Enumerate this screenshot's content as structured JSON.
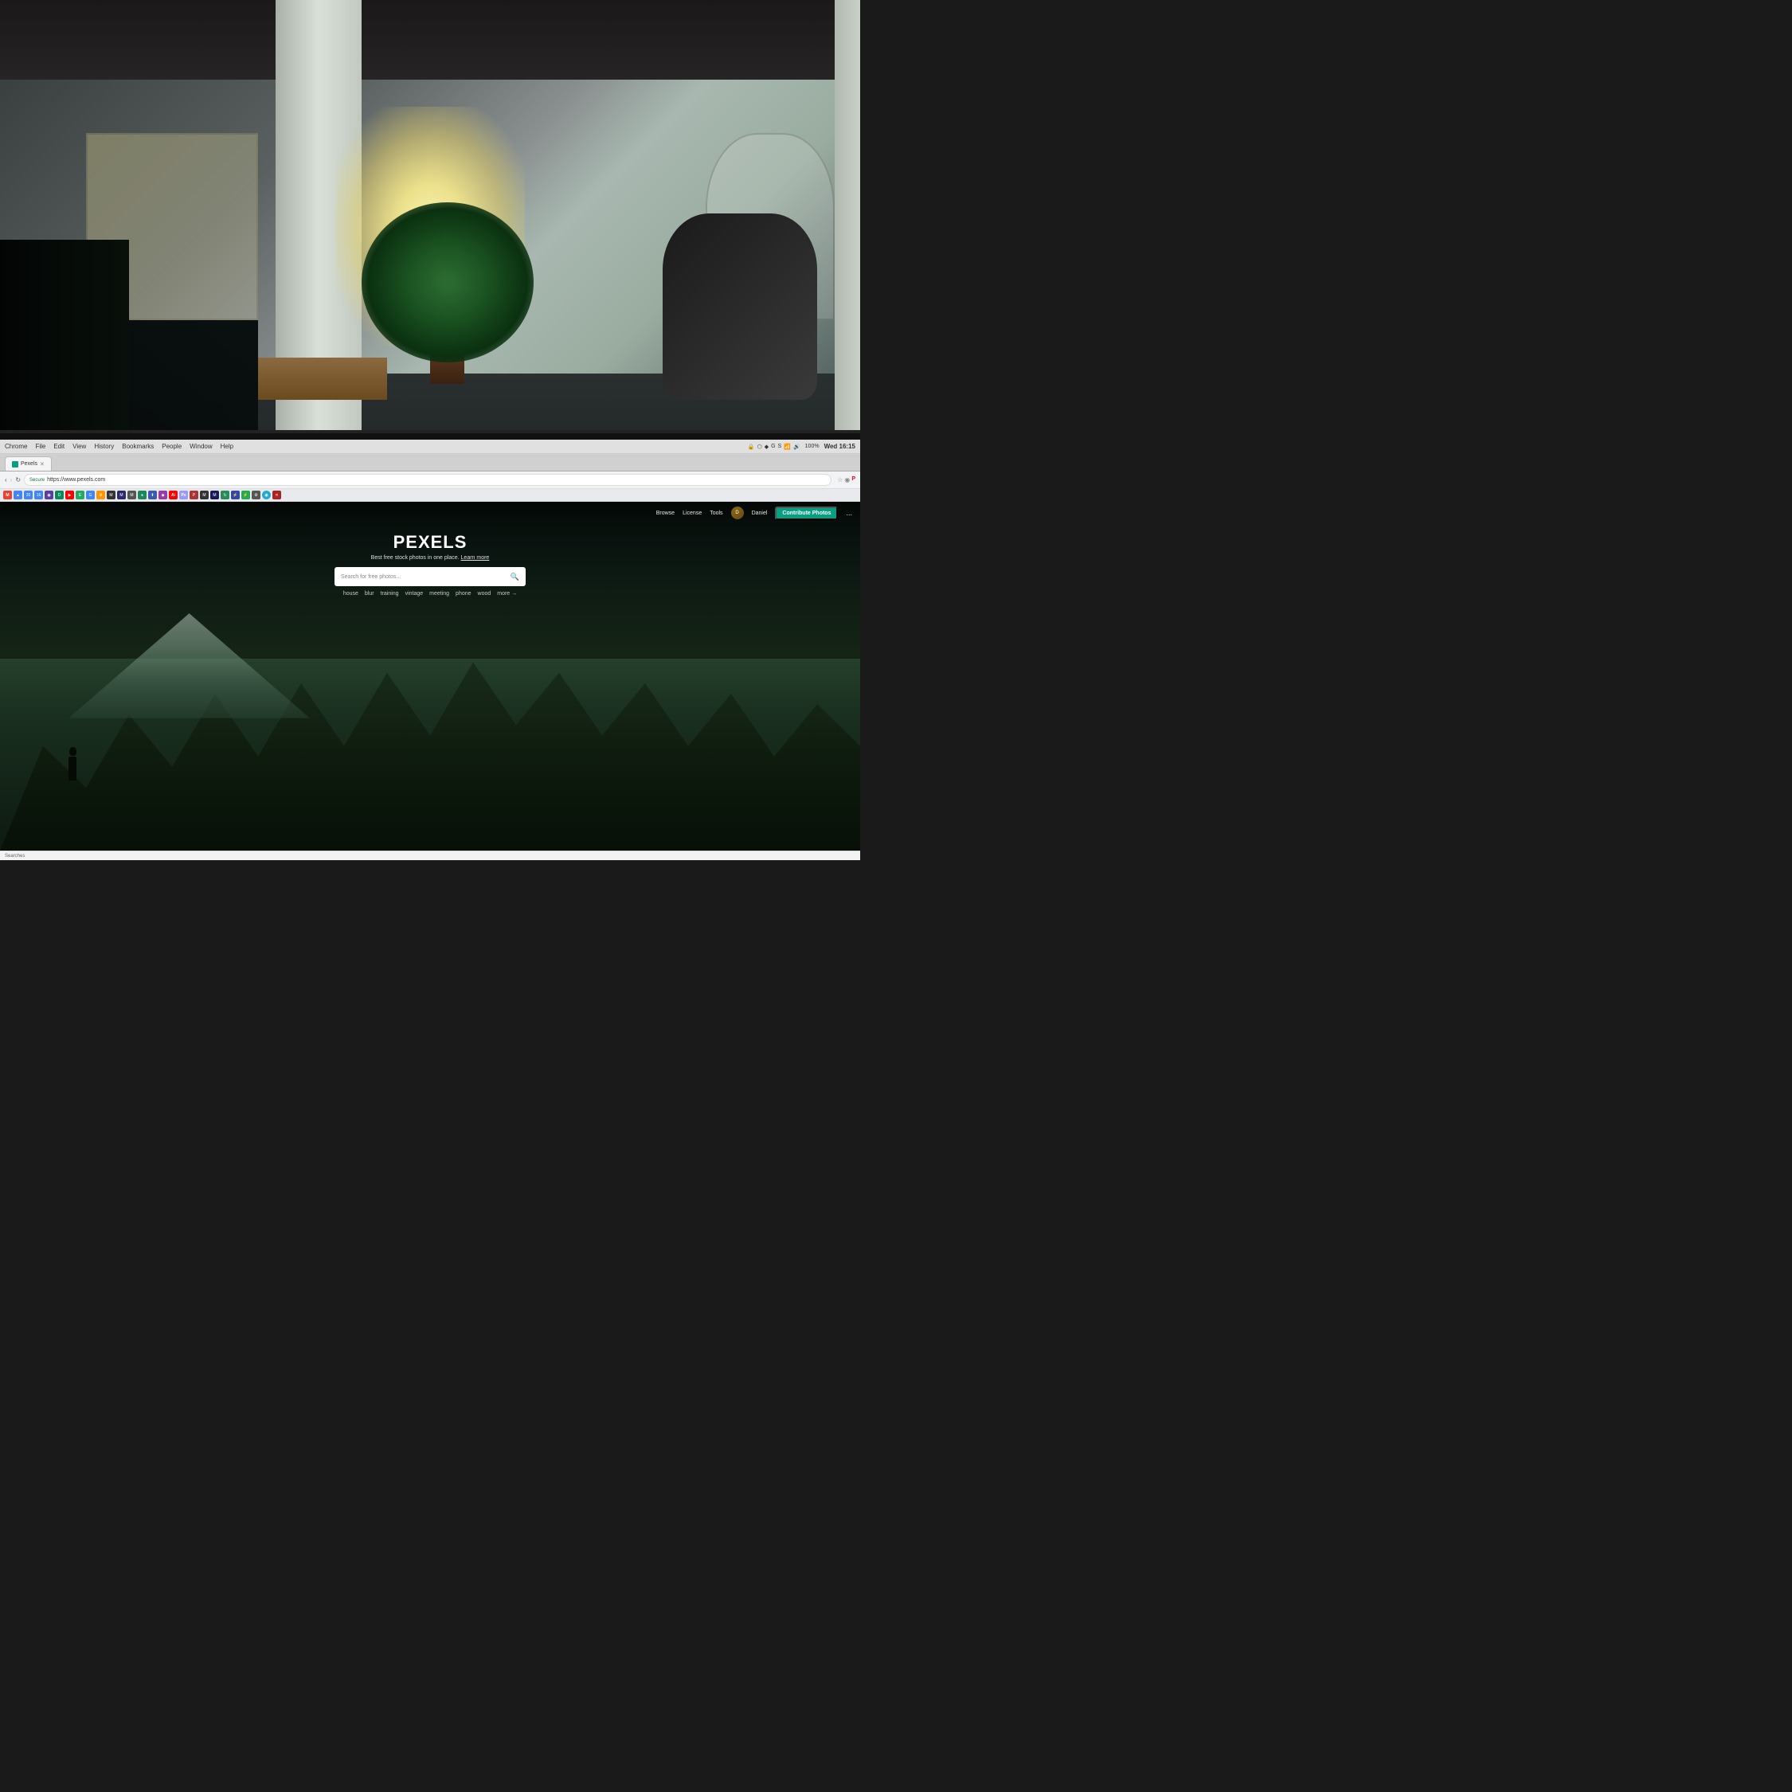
{
  "photo": {
    "description": "Office workspace background photo with laptop showing Pexels website"
  },
  "browser": {
    "menu": {
      "items": [
        "Chrome",
        "File",
        "Edit",
        "View",
        "History",
        "Bookmarks",
        "People",
        "Window",
        "Help"
      ]
    },
    "system": {
      "time": "Wed 16:15",
      "battery": "100%",
      "wifi": "on"
    },
    "tab": {
      "title": "Pexels",
      "favicon": "P",
      "url_secure_label": "Secure",
      "url": "https://www.pexels.com"
    },
    "address_bar": {
      "secure_label": "Secure",
      "url": "https://www.pexels.com"
    },
    "status_bar": {
      "text": "Searches"
    }
  },
  "pexels": {
    "nav": {
      "browse_label": "Browse",
      "license_label": "License",
      "tools_label": "Tools",
      "user_name": "Daniel",
      "user_initial": "D",
      "contribute_label": "Contribute Photos",
      "more_label": "..."
    },
    "hero": {
      "logo": "PEXELS",
      "subtitle": "Best free stock photos in one place.",
      "learn_more": "Learn more",
      "search_placeholder": "Search for free photos...",
      "tags": [
        "house",
        "blur",
        "training",
        "vintage",
        "meeting",
        "phone",
        "wood"
      ],
      "more_tag": "more →"
    }
  },
  "extensions": {
    "icons": [
      "M",
      "G",
      "20",
      "16",
      "◉",
      "D",
      "▶",
      "E",
      "G",
      "⚙",
      "M",
      "M",
      "M",
      "●",
      "⬆",
      "◆",
      "A",
      "A",
      "P",
      "M",
      "M",
      "M",
      "⚡",
      "⚡",
      "⚙",
      "◉",
      "✖"
    ]
  }
}
